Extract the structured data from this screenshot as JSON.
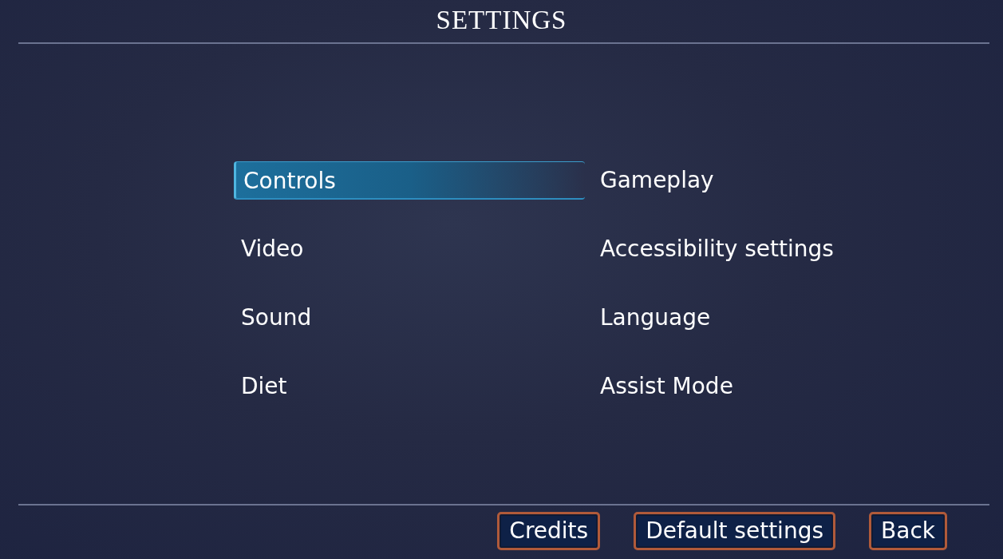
{
  "title": "SETTINGS",
  "menu_items": [
    {
      "label": "Controls",
      "selected": true
    },
    {
      "label": "Gameplay",
      "selected": false
    },
    {
      "label": "Video",
      "selected": false
    },
    {
      "label": "Accessibility settings",
      "selected": false
    },
    {
      "label": "Sound",
      "selected": false
    },
    {
      "label": "Language",
      "selected": false
    },
    {
      "label": "Diet",
      "selected": false
    },
    {
      "label": "Assist Mode",
      "selected": false
    }
  ],
  "buttons": [
    "Credits",
    "Default settings",
    "Back"
  ]
}
